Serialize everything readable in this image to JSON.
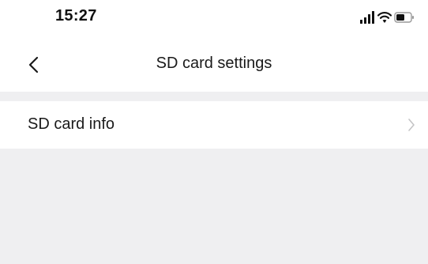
{
  "status_bar": {
    "time": "15:27",
    "icons": [
      "signal-icon",
      "wifi-icon",
      "battery-icon"
    ]
  },
  "nav": {
    "title": "SD card settings",
    "back_icon": "chevron-left-icon"
  },
  "settings": {
    "items": [
      {
        "label": "SD card info",
        "icon": "chevron-right-icon"
      }
    ]
  },
  "colors": {
    "background": "#efeff1",
    "surface": "#ffffff",
    "text": "#1a1a1a",
    "chevron": "#c4c4c6"
  }
}
